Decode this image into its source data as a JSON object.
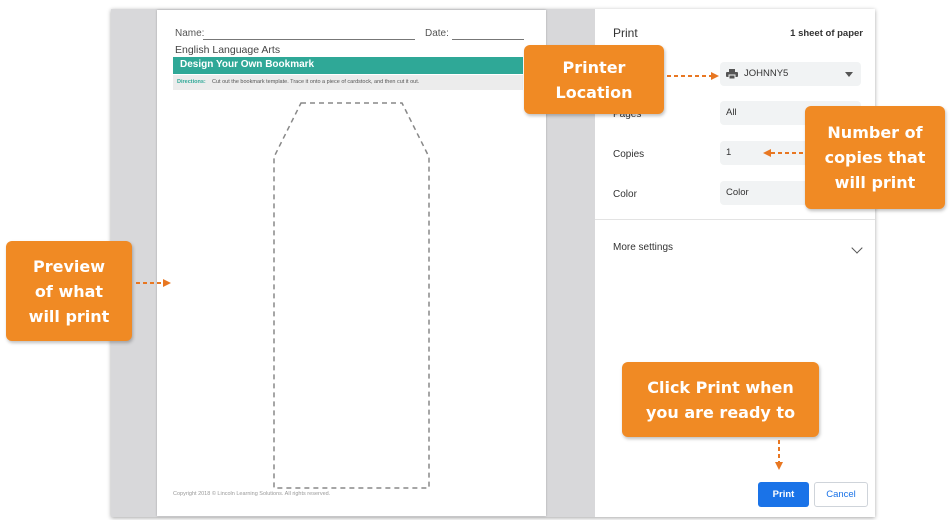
{
  "worksheet": {
    "name_label": "Name:",
    "date_label": "Date:",
    "subject": "English Language Arts",
    "title": "Design Your Own Bookmark",
    "directions_label": "Directions:",
    "directions_text": "Cut out the bookmark template. Trace it onto a piece of cardstock, and then cut it out.",
    "footer": "Copyright 2018 © Lincoln Learning Solutions. All rights reserved."
  },
  "settings": {
    "title": "Print",
    "sheets": "1 sheet of paper",
    "destination_value": "JOHNNY5",
    "destination_icon": "printer-icon",
    "pages_label": "Pages",
    "pages_value": "All",
    "copies_label": "Copies",
    "copies_value": "1",
    "color_label": "Color",
    "color_value": "Color",
    "more_settings": "More settings",
    "print_button": "Print",
    "cancel_button": "Cancel"
  },
  "callouts": {
    "printer": "Printer\nLocation",
    "copies": "Number of\ncopies that\nwill print",
    "preview": "Preview\nof what\nwill print",
    "print": "Click Print when\nyou are ready to"
  },
  "colors": {
    "callout": "#f08a24",
    "accent_teal": "#2fa897",
    "print_button": "#1a73e8",
    "arrow": "#e87722"
  }
}
